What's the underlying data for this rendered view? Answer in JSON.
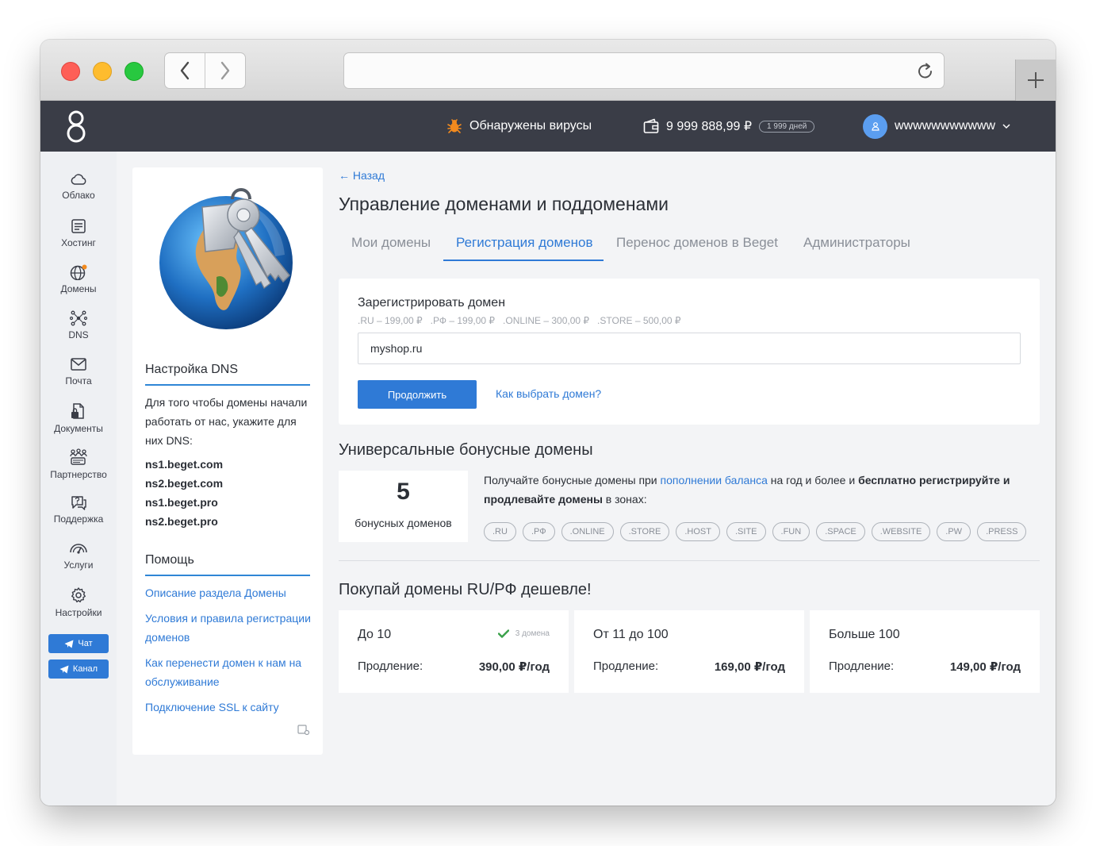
{
  "header": {
    "virus_text": "Обнаружены вирусы",
    "balance": "9 999 888,99 ₽",
    "days": "1 999 дней",
    "username": "wwwwwwwwwww"
  },
  "sidebar": {
    "items": [
      {
        "label": "Облако",
        "icon": "cloud-icon"
      },
      {
        "label": "Хостинг",
        "icon": "hosting-icon"
      },
      {
        "label": "Домены",
        "icon": "globe-icon"
      },
      {
        "label": "DNS",
        "icon": "dns-icon"
      },
      {
        "label": "Почта",
        "icon": "mail-icon"
      },
      {
        "label": "Документы",
        "icon": "documents-icon"
      },
      {
        "label": "Партнерство",
        "icon": "partnership-icon"
      },
      {
        "label": "Поддержка",
        "icon": "support-icon"
      },
      {
        "label": "Услуги",
        "icon": "services-icon"
      },
      {
        "label": "Настройки",
        "icon": "settings-icon"
      }
    ],
    "chat": "Чат",
    "channel": "Канал"
  },
  "left_panel": {
    "dns_title": "Настройка DNS",
    "dns_text": "Для того чтобы домены начали работать от нас, укажите для них DNS:",
    "nameservers": [
      "ns1.beget.com",
      "ns2.beget.com",
      "ns1.beget.pro",
      "ns2.beget.pro"
    ],
    "help_title": "Помощь",
    "help_links": [
      "Описание раздела Домены",
      "Условия и правила регистрации доменов",
      "Как перенести домен к нам на обслуживание",
      "Подключение SSL к сайту"
    ]
  },
  "main": {
    "back": "Назад",
    "title": "Управление доменами и поддоменами",
    "tabs": [
      "Мои домены",
      "Регистрация доменов",
      "Перенос доменов в Beget",
      "Администраторы"
    ],
    "active_tab": "Регистрация доменов",
    "register": {
      "title": "Зарегистрировать домен",
      "prices": ".RU – 199,00 ₽   .РФ – 199,00 ₽   .ONLINE – 300,00 ₽   .STORE – 500,00 ₽",
      "input_value": "myshop.ru",
      "button": "Продолжить",
      "how_link": "Как выбрать домен?"
    },
    "bonus": {
      "title": "Универсальные бонусные домены",
      "count": "5",
      "count_label": "бонусных доменов",
      "text_1": "Получайте бонусные домены при ",
      "link": "пополнении баланса",
      "text_2": " на год и более и ",
      "bold": "бесплатно регистрируйте и продлевайте домены",
      "text_3": " в зонах:",
      "zones": [
        ".RU",
        ".РФ",
        ".ONLINE",
        ".STORE",
        ".HOST",
        ".SITE",
        ".FUN",
        ".SPACE",
        ".WEBSITE",
        ".PW",
        ".PRESS"
      ]
    },
    "cheap": {
      "title": "Покупай домены RU/РФ дешевле!",
      "cards": [
        {
          "title": "До 10",
          "badge": "3 домена",
          "label": "Продление:",
          "value": "390,00 ₽/год"
        },
        {
          "title": "От 11 до 100",
          "label": "Продление:",
          "value": "169,00 ₽/год"
        },
        {
          "title": "Больше 100",
          "label": "Продление:",
          "value": "149,00 ₽/год"
        }
      ]
    }
  },
  "colors": {
    "accent": "#2f7ad6",
    "topbar": "#3a3d47",
    "background": "#f3f4f6"
  }
}
